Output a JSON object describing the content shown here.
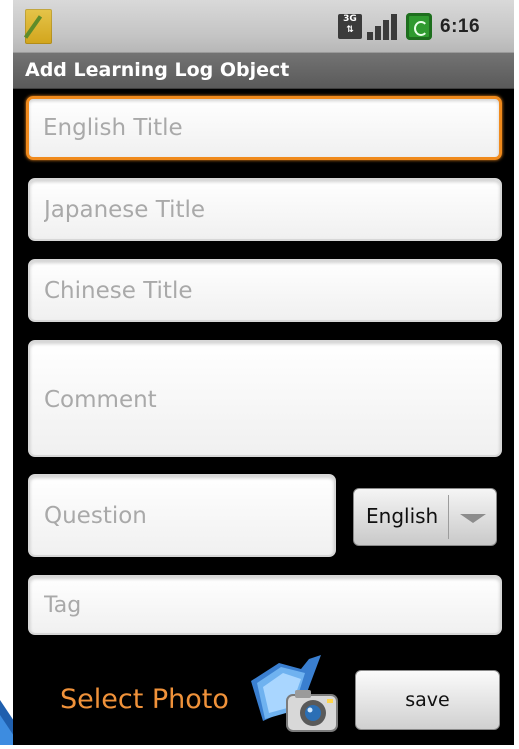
{
  "status_bar": {
    "network_label": "3G",
    "clock": "6:16"
  },
  "title_bar": {
    "title": "Add Learning Log Object"
  },
  "form": {
    "english_title": {
      "value": "",
      "placeholder": "English Title"
    },
    "japanese_title": {
      "value": "",
      "placeholder": "Japanese Title"
    },
    "chinese_title": {
      "value": "",
      "placeholder": "Chinese Title"
    },
    "comment": {
      "value": "",
      "placeholder": "Comment"
    },
    "question": {
      "value": "",
      "placeholder": "Question"
    },
    "question_language": {
      "selected": "English"
    },
    "tag": {
      "value": "",
      "placeholder": "Tag"
    }
  },
  "actions": {
    "select_photo_label": "Select Photo",
    "save_label": "save"
  },
  "colors": {
    "focus_border": "#f08a1c",
    "select_photo_text": "#f0923a",
    "title_bar": "#666666",
    "status_bar": "#cccccc"
  },
  "icons": {
    "app": "app-pencil-icon",
    "network": "3g-icon",
    "signal": "signal-icon",
    "battery": "battery-charging-icon",
    "photo": "folder-camera-icon",
    "spinner": "chevron-down-icon"
  }
}
